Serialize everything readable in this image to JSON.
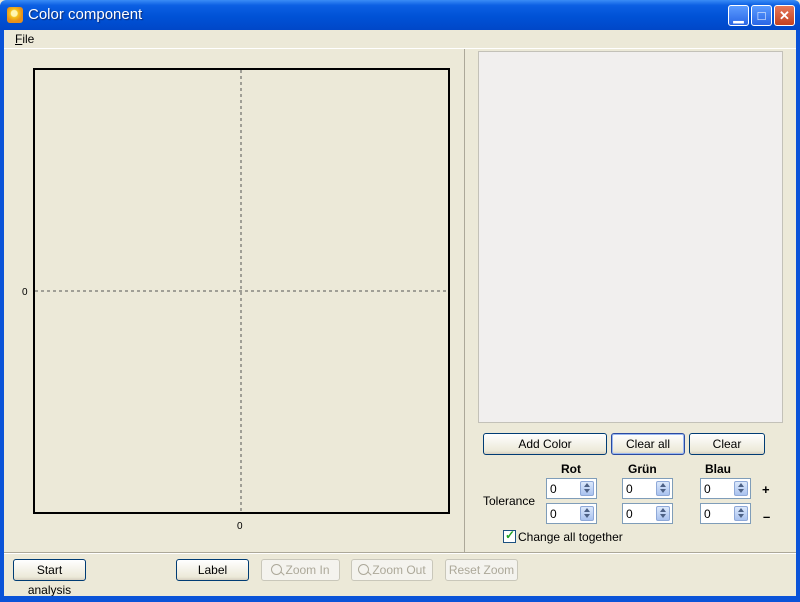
{
  "window": {
    "title": "Color component"
  },
  "menu": {
    "file_label": "File",
    "file_mnemonic": "F",
    "file_rest": "ile"
  },
  "plot": {
    "x_origin_label": "0",
    "y_origin_label": "0"
  },
  "color_panel": {
    "add_color_label": "Add Color",
    "clear_all_label": "Clear all",
    "clear_label": "Clear",
    "columns": [
      "Rot",
      "Grün",
      "Blau"
    ],
    "tolerance_label": "Tolerance",
    "plus_sign": "+",
    "minus_sign": "–",
    "tolerance_plus": {
      "rot": "0",
      "grun": "0",
      "blau": "0"
    },
    "tolerance_minus": {
      "rot": "0",
      "grun": "0",
      "blau": "0"
    },
    "change_all_together_label": "Change all together",
    "change_all_together_checked": true
  },
  "bottom_bar": {
    "start_analysis_label": "Start analysis",
    "label_label": "Label",
    "zoom_in_label": "Zoom In",
    "zoom_out_label": "Zoom Out",
    "reset_zoom_label": "Reset Zoom"
  },
  "icons": {
    "app": "app-icon",
    "minimize": "minimize-icon",
    "maximize": "maximize-icon",
    "close": "close-icon",
    "zoom_in": "magnifier-plus-icon",
    "zoom_out": "magnifier-minus-icon",
    "checkbox": "checkmark-icon"
  },
  "colors": {
    "titlebar": "#0052d6",
    "window_bg": "#ece9d8",
    "button_border": "#003c74",
    "close_button": "#c2411f"
  }
}
